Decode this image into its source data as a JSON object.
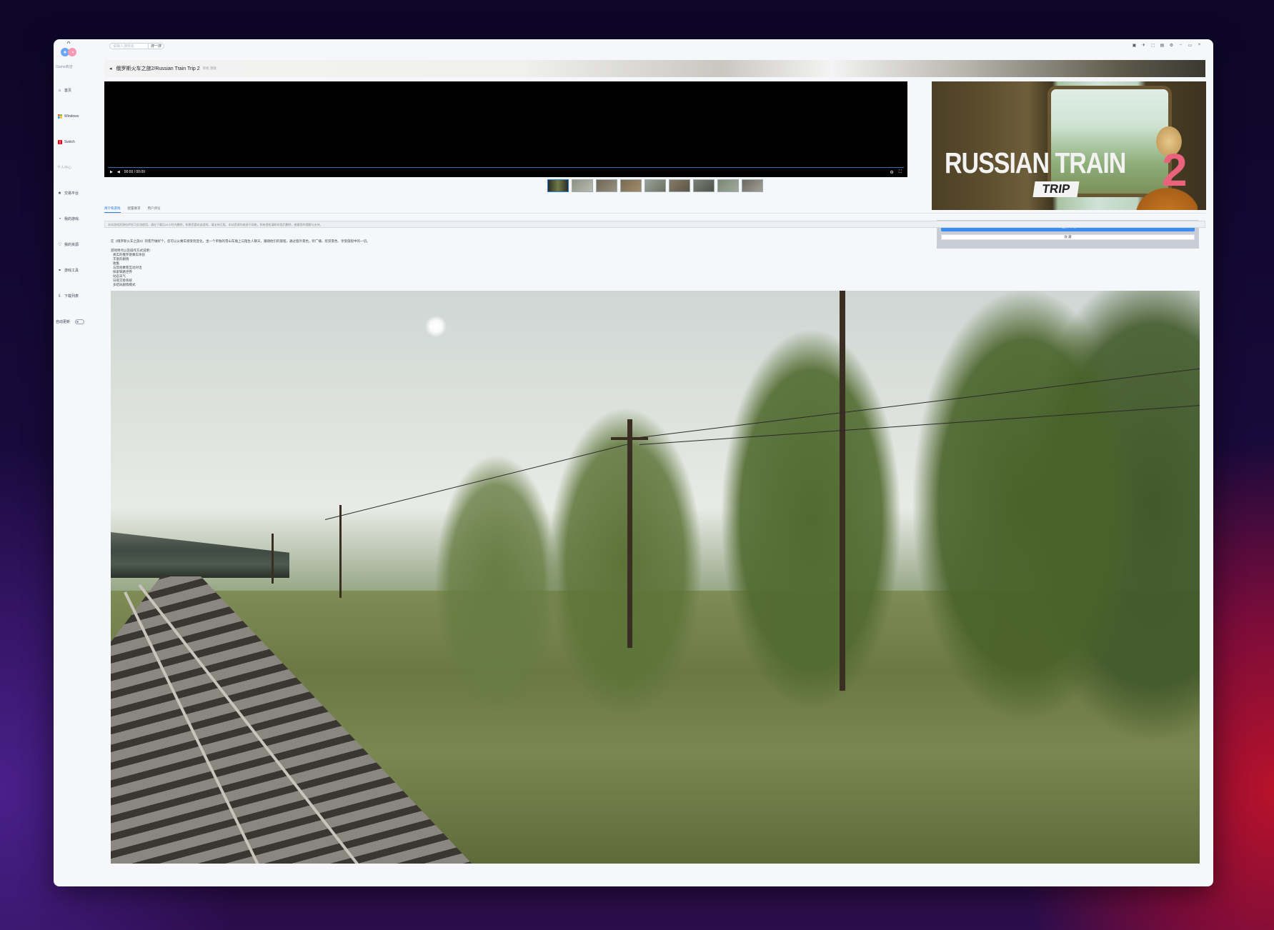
{
  "sidebar": {
    "logo_label": "Game商店",
    "items": [
      {
        "label": "首页",
        "icon": "home-icon"
      },
      {
        "label": "Windows",
        "icon": "windows-icon"
      },
      {
        "label": "Switch",
        "icon": "switch-icon"
      }
    ],
    "section_label": "个人中心",
    "user_items": [
      {
        "label": "交易平台",
        "icon": "star-icon"
      },
      {
        "label": "我的游戏",
        "icon": "gamepad-icon"
      },
      {
        "label": "我的资源",
        "icon": "heart-icon"
      },
      {
        "label": "游戏工具",
        "icon": "link-icon"
      },
      {
        "label": "下载列表",
        "icon": "download-icon"
      }
    ],
    "toggle_label": "自动更新"
  },
  "topbar": {
    "search_placeholder": "请输入游戏名",
    "search_button": "搜一搜"
  },
  "window_controls": [
    "▣",
    "✈",
    "⬚",
    "▤",
    "⚙",
    "−",
    "▭",
    "×"
  ],
  "header": {
    "back_icon": "◂",
    "title": "俄罗斯火车之旅2/Russian Train Trip 2",
    "subtitle": "单机 游戏"
  },
  "video": {
    "time": "00:00 / 00:00"
  },
  "thumbnails_count": 9,
  "cover": {
    "line1": "RUSSIAN TRAIN",
    "line2": "2",
    "line3": "TRIP"
  },
  "download": {
    "button_label": "⭳ 立即下载",
    "fav_label": "收 藏"
  },
  "tabs": [
    {
      "label": "简介和游戏",
      "active": true
    },
    {
      "label": "配置要求",
      "active": false
    },
    {
      "label": "用户评论",
      "active": false
    }
  ],
  "notice": "本站游戏资源仅供学习交流使用，请在下载后24小时内删除，如果您喜欢该游戏，请支持正版。本站资源均来源于网络，如有侵权请联系我们删除，感谢您的理解与支持。",
  "description": "在《俄罗斯火车之旅2》的客厅做好个，您可以从乘车感受到变化，坐一个单独的雪山车厢上与陌生人聊天，跟随他们的旅程，通过窗外景色，听广播、欣赏景色、享受旅程中的一切。",
  "features_title": "游戏特点以及操作方式说明：",
  "features": [
    "真实的俄罗斯乘车体验",
    "丰富的剧情",
    "收集",
    "与其他乘客互动对话",
    "探索铁路世界",
    "动态天气",
    "日夜交替系统",
    "多结局剧情模式"
  ]
}
